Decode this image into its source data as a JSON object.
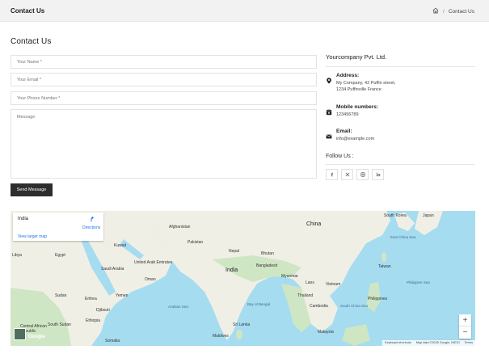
{
  "header": {
    "title": "Contact Us",
    "breadcrumb_separator": "/",
    "breadcrumb_current": "Contact Us",
    "home_icon": "home-icon"
  },
  "page_heading": "Contact Us",
  "form": {
    "name_placeholder": "Your Name *",
    "email_placeholder": "Your Email *",
    "phone_placeholder": "Your Phone Number *",
    "message_placeholder": "Message",
    "send_label": "Send Message"
  },
  "info": {
    "company": "Yourcompany Pvt. Ltd.",
    "address_label": "Address:",
    "address_line1": "My Company, 42 Puffin street,",
    "address_line2": "1234 Puffinville France",
    "mobile_label": "Mobile numbers:",
    "mobile_value": "123456789",
    "email_label": "Email:",
    "email_value": "info@example.com",
    "follow_label": "Follow Us :",
    "socials": [
      "facebook-icon",
      "x-twitter-icon",
      "instagram-icon",
      "linkedin-icon"
    ]
  },
  "map": {
    "place": "India",
    "directions": "Directions",
    "view_larger": "View larger map",
    "zoom_in": "+",
    "zoom_out": "−",
    "google": "Google",
    "keyboard": "Keyboard shortcuts",
    "map_data": "Map data ©2025 Google, INEGI",
    "terms": "Terms",
    "labels": {
      "china": "China",
      "india": "India",
      "afghanistan": "Afghanistan",
      "pakistan": "Pakistan",
      "kuwait": "Kuwait",
      "egypt": "Egypt",
      "libya": "Libya",
      "saudi": "Saudi Arabia",
      "uae": "United Arab Emirates",
      "oman": "Oman",
      "sudan": "Sudan",
      "yemen": "Yemen",
      "eritrea": "Eritrea",
      "djibouti": "Djibouti",
      "ethiopia": "Ethiopia",
      "somalia": "Somalia",
      "south_sudan": "South Sudan",
      "car": "Central African Republic",
      "nepal": "Nepal",
      "bhutan": "Bhutan",
      "bangladesh": "Bangladesh",
      "myanmar": "Myanmar",
      "laos": "Laos",
      "thailand": "Thailand",
      "vietnam": "Vietnam",
      "cambodia": "Cambodia",
      "philippines": "Philippines",
      "sri_lanka": "Sri Lanka",
      "malaysia": "Malaysia",
      "south_korea": "South Korea",
      "japan": "Japan",
      "taiwan": "Taiwan",
      "east_china_sea": "East China Sea",
      "philippine_sea": "Philippine Sea",
      "bay_of_bengal": "Bay of Bengal",
      "arabian_sea": "Arabian Sea",
      "south_china_sea": "South China Sea",
      "maldives": "Maldives"
    }
  },
  "colors": {
    "button": "#2e2e2e",
    "water": "#9fd8ef",
    "land": "#f0efe6",
    "green": "#cfe6c4",
    "link": "#1a73e8"
  }
}
